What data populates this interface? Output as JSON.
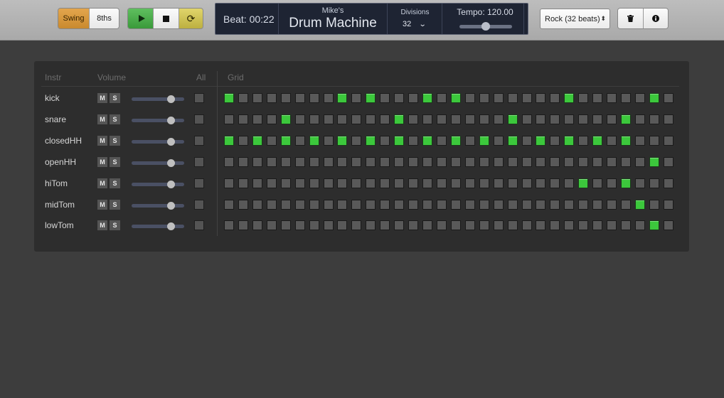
{
  "toolbar": {
    "swing_label": "Swing",
    "eighths_label": "8ths",
    "play_icon": "play-icon",
    "stop_icon": "stop-icon",
    "loop_icon": "loop-icon",
    "pattern_select_value": "Rock (32 beats)",
    "trash_icon": "trash-icon",
    "info_icon": "info-icon"
  },
  "display": {
    "beat_text": "Beat: 00:22",
    "subtitle": "Mike's",
    "title": "Drum Machine",
    "divisions_label": "Divisions",
    "divisions_value": "32",
    "tempo_text": "Tempo: 120.00",
    "tempo_slider_fraction": 0.5
  },
  "headers": {
    "instr": "Instr",
    "volume": "Volume",
    "all": "All",
    "grid": "Grid"
  },
  "tracks": [
    {
      "name": "kick",
      "mute": "M",
      "solo": "S",
      "volume_fraction": 0.75,
      "steps": [
        1,
        0,
        0,
        0,
        0,
        0,
        0,
        0,
        1,
        0,
        1,
        0,
        0,
        0,
        1,
        0,
        1,
        0,
        0,
        0,
        0,
        0,
        0,
        0,
        1,
        0,
        0,
        0,
        0,
        0,
        1,
        0
      ]
    },
    {
      "name": "snare",
      "mute": "M",
      "solo": "S",
      "volume_fraction": 0.75,
      "steps": [
        0,
        0,
        0,
        0,
        1,
        0,
        0,
        0,
        0,
        0,
        0,
        0,
        1,
        0,
        0,
        0,
        0,
        0,
        0,
        0,
        1,
        0,
        0,
        0,
        0,
        0,
        0,
        0,
        1,
        0,
        0,
        0
      ]
    },
    {
      "name": "closedHH",
      "mute": "M",
      "solo": "S",
      "volume_fraction": 0.75,
      "steps": [
        1,
        0,
        1,
        0,
        1,
        0,
        1,
        0,
        1,
        0,
        1,
        0,
        1,
        0,
        1,
        0,
        1,
        0,
        1,
        0,
        1,
        0,
        1,
        0,
        1,
        0,
        1,
        0,
        1,
        0,
        0,
        0
      ]
    },
    {
      "name": "openHH",
      "mute": "M",
      "solo": "S",
      "volume_fraction": 0.75,
      "steps": [
        0,
        0,
        0,
        0,
        0,
        0,
        0,
        0,
        0,
        0,
        0,
        0,
        0,
        0,
        0,
        0,
        0,
        0,
        0,
        0,
        0,
        0,
        0,
        0,
        0,
        0,
        0,
        0,
        0,
        0,
        1,
        0
      ]
    },
    {
      "name": "hiTom",
      "mute": "M",
      "solo": "S",
      "volume_fraction": 0.75,
      "steps": [
        0,
        0,
        0,
        0,
        0,
        0,
        0,
        0,
        0,
        0,
        0,
        0,
        0,
        0,
        0,
        0,
        0,
        0,
        0,
        0,
        0,
        0,
        0,
        0,
        0,
        1,
        0,
        0,
        1,
        0,
        0,
        0
      ]
    },
    {
      "name": "midTom",
      "mute": "M",
      "solo": "S",
      "volume_fraction": 0.75,
      "steps": [
        0,
        0,
        0,
        0,
        0,
        0,
        0,
        0,
        0,
        0,
        0,
        0,
        0,
        0,
        0,
        0,
        0,
        0,
        0,
        0,
        0,
        0,
        0,
        0,
        0,
        0,
        0,
        0,
        0,
        1,
        0,
        0
      ]
    },
    {
      "name": "lowTom",
      "mute": "M",
      "solo": "S",
      "volume_fraction": 0.75,
      "steps": [
        0,
        0,
        0,
        0,
        0,
        0,
        0,
        0,
        0,
        0,
        0,
        0,
        0,
        0,
        0,
        0,
        0,
        0,
        0,
        0,
        0,
        0,
        0,
        0,
        0,
        0,
        0,
        0,
        0,
        0,
        1,
        0
      ]
    }
  ],
  "colors": {
    "step_on": "#3cc83c",
    "step_off": "#595959",
    "swing_accent": "#d89a3e",
    "play_accent": "#4caf4c",
    "loop_accent": "#d1c553",
    "display_bg": "#1e2433"
  }
}
